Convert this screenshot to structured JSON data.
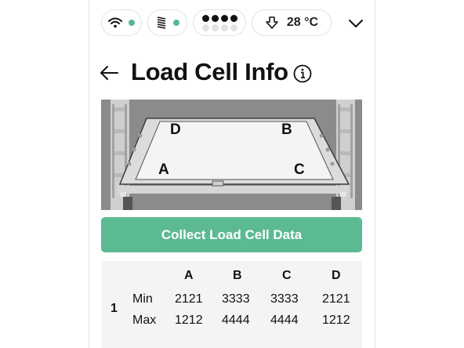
{
  "status_bar": {
    "wifi": {
      "icon": "wifi-icon",
      "status_color": "#55b894"
    },
    "stack": {
      "icon": "stacked-layers-icon",
      "status_color": "#55b894"
    },
    "slots": {
      "icon": "slot-dots-icon",
      "filled_top_row": 4,
      "total": 8
    },
    "temperature": {
      "icon": "thermometer-down-icon",
      "value": "28 °C"
    },
    "menu": {
      "icon": "chevron-down-icon"
    }
  },
  "header": {
    "back_icon": "arrow-left-icon",
    "title": "Load Cell Info",
    "info_icon": "info-icon"
  },
  "figure": {
    "labels": {
      "a": "A",
      "b": "B",
      "c": "C",
      "d": "D"
    }
  },
  "actions": {
    "collect_label": "Collect Load Cell Data",
    "accent_color": "#5cba92"
  },
  "table": {
    "columns": [
      "A",
      "B",
      "C",
      "D"
    ],
    "rows": [
      {
        "index": "1",
        "min_label": "Min",
        "max_label": "Max",
        "min": [
          "2121",
          "3333",
          "3333",
          "2121"
        ],
        "max": [
          "1212",
          "4444",
          "4444",
          "1212"
        ]
      }
    ]
  }
}
